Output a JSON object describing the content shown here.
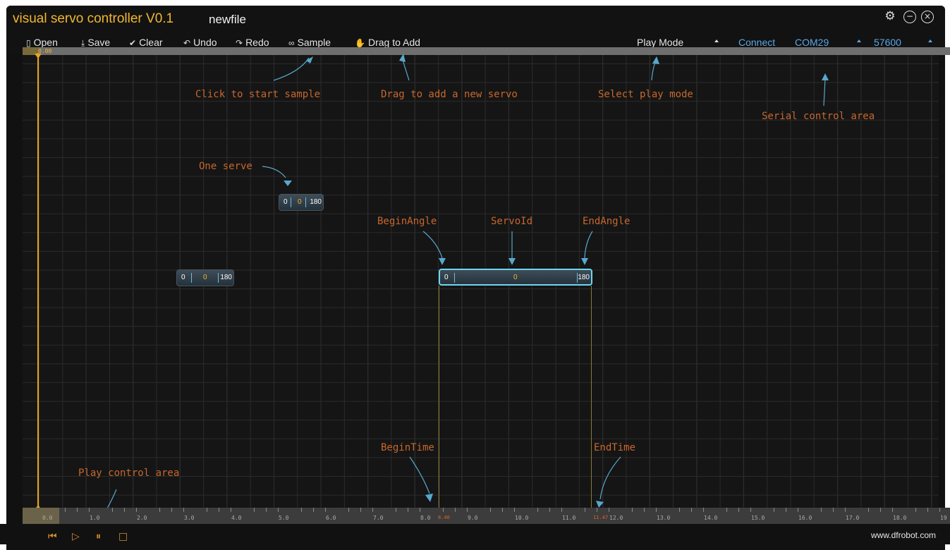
{
  "title": {
    "app": "visual servo controller V0.1",
    "file": "newfile"
  },
  "window_controls": {
    "settings": "⚙",
    "minimize": "−",
    "close": "×"
  },
  "toolbar": {
    "open": "Open",
    "save": "Save",
    "clear": "Clear",
    "undo": "Undo",
    "redo": "Redo",
    "sample": "Sample",
    "drag_to_add": "Drag to Add",
    "play_mode": "Play Mode",
    "connect": "Connect",
    "port": "COM29",
    "baud": "57600"
  },
  "top_ruler": {
    "start": "0.00"
  },
  "annotations": {
    "click_sample": "Click to start sample",
    "drag_add": "Drag to add a new servo",
    "select_play": "Select play mode",
    "serial_area": "Serial control area",
    "one_servo": "One serve",
    "begin_angle": "BeginAngle",
    "servo_id": "ServoId",
    "end_angle": "EndAngle",
    "begin_time": "BeginTime",
    "end_time": "EndTime",
    "play_control": "Play control area"
  },
  "servos": [
    {
      "begin": "0",
      "id": "0",
      "end": "180"
    },
    {
      "begin": "0",
      "id": "0",
      "end": "180"
    },
    {
      "begin": "0",
      "id": "0",
      "end": "180"
    }
  ],
  "timeline": {
    "ticks": [
      "0.0",
      "1.0",
      "2.0",
      "3.0",
      "4.0",
      "5.0",
      "6.0",
      "7.0",
      "8.0",
      "9.0",
      "10.0",
      "11.0",
      "12.0",
      "13.0",
      "14.0",
      "15.0",
      "16.0",
      "17.0",
      "18.0",
      "19"
    ],
    "begin_marker": "8.40",
    "end_marker": "11.47"
  },
  "playbar": {
    "prev": "⏮",
    "play": "▷",
    "pause": "⏸",
    "stop": "□"
  },
  "footer": "www.dfrobot.com",
  "colors": {
    "accent": "#f0b72f",
    "annotation": "#c8672d",
    "selected": "#6fd6f0",
    "link": "#5aa8e8"
  }
}
